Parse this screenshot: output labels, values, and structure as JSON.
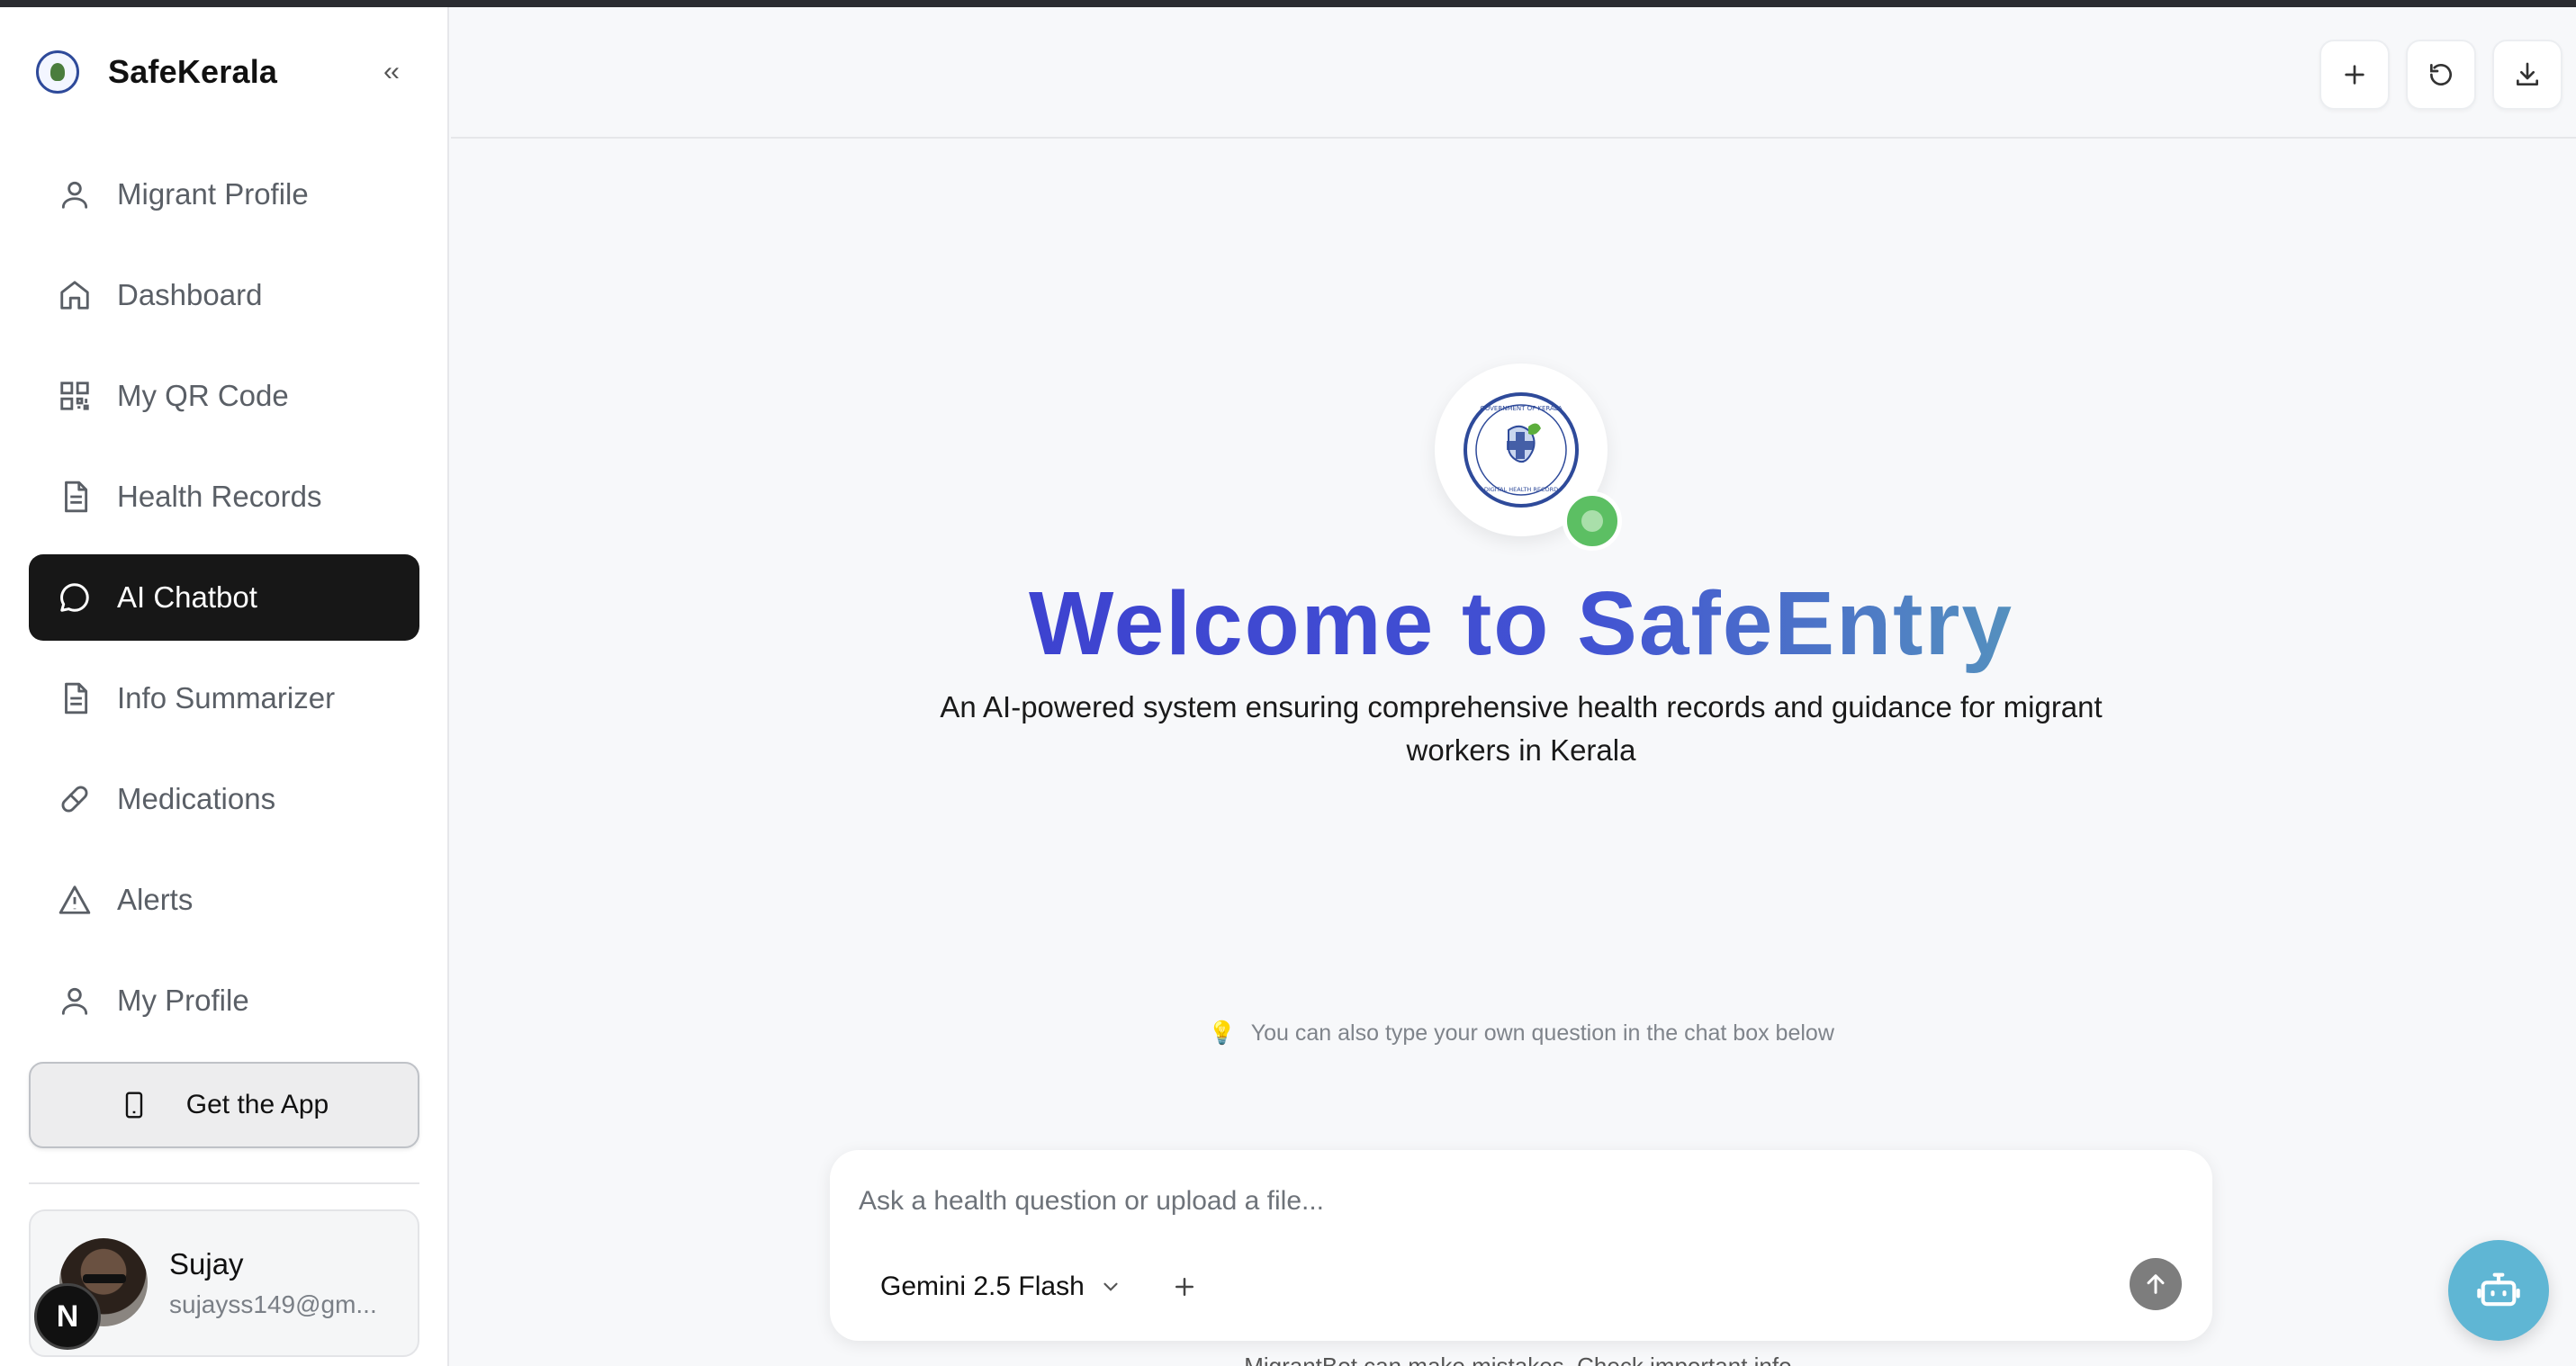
{
  "app": {
    "brand_name": "SafeKerala",
    "collapse_label": "‹‹"
  },
  "sidebar": {
    "items": [
      {
        "label": "Migrant Profile",
        "icon": "user-icon",
        "active": false
      },
      {
        "label": "Dashboard",
        "icon": "home-icon",
        "active": false
      },
      {
        "label": "My QR Code",
        "icon": "qr-code-icon",
        "active": false
      },
      {
        "label": "Health Records",
        "icon": "document-icon",
        "active": false
      },
      {
        "label": "AI Chatbot",
        "icon": "chat-bubble-icon",
        "active": true
      },
      {
        "label": "Info Summarizer",
        "icon": "document-icon",
        "active": false
      },
      {
        "label": "Medications",
        "icon": "pill-icon",
        "active": false
      },
      {
        "label": "Alerts",
        "icon": "warning-icon",
        "active": false
      },
      {
        "label": "My Profile",
        "icon": "user-icon",
        "active": false
      }
    ],
    "get_app_label": "Get the App"
  },
  "user": {
    "name": "Sujay",
    "email": "sujayss149@gm...",
    "badge": "N"
  },
  "header": {
    "actions": [
      "plus-icon",
      "refresh-icon",
      "download-icon"
    ]
  },
  "hero": {
    "logo_text_top": "GOVERNMENT OF KERALA",
    "logo_text_bottom": "DIGITAL HEALTH RECORD",
    "title": "Welcome to SafeEntry",
    "subtitle_line1": "An AI-powered system ensuring comprehensive health records and guidance for migrant",
    "subtitle_line2": "workers in Kerala"
  },
  "hint": {
    "icon": "💡",
    "text": "You can also type your own question in the chat box below"
  },
  "chat": {
    "placeholder": "Ask a health question or upload a file...",
    "value": "",
    "model": "Gemini 2.5 Flash",
    "disclaimer": "MigrantBot can make mistakes. Check important info."
  },
  "colors": {
    "active_nav_bg": "#171717",
    "title_gradient_start": "#3c3fcf",
    "title_gradient_end": "#5aa3b8",
    "status_green": "#5cbf63",
    "fab_blue": "#5fb6d4"
  }
}
